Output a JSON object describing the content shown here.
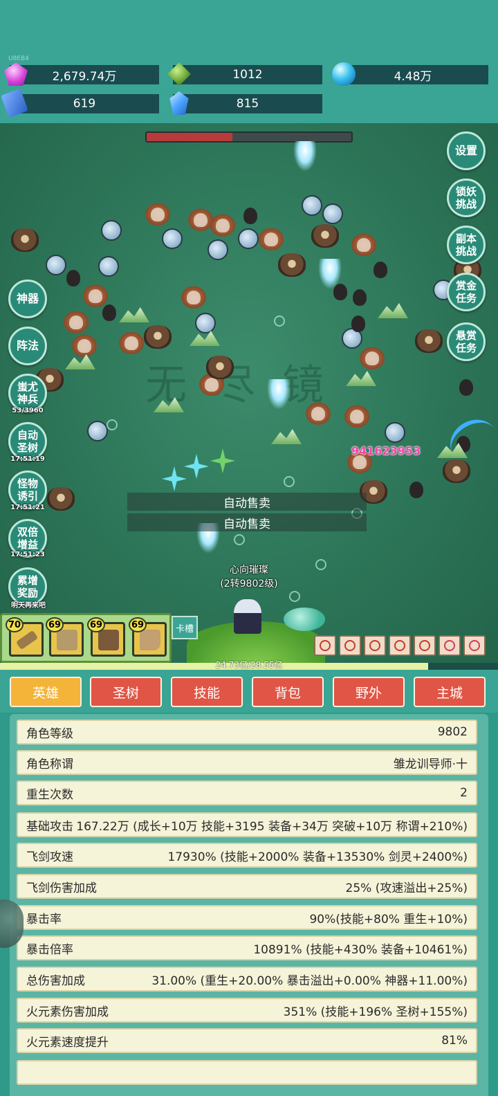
{
  "uid": "U8EB4",
  "resources": [
    {
      "icon": "gem-icon",
      "value": "2,679.74万"
    },
    {
      "icon": "jade-icon",
      "value": "1012"
    },
    {
      "icon": "orb-icon",
      "value": "4.48万"
    },
    {
      "icon": "book-icon",
      "value": "619"
    },
    {
      "icon": "crystal-icon",
      "value": "815"
    }
  ],
  "right_buttons": [
    "设置",
    "锁妖挑战",
    "副本挑战",
    "赏金任务",
    "悬赏任务"
  ],
  "left_buttons": [
    {
      "label": "神器",
      "timer": ""
    },
    {
      "label": "阵法",
      "timer": ""
    },
    {
      "label": "蚩尤神兵",
      "timer": "53/3960"
    },
    {
      "label": "自动圣树",
      "timer": "17:51:19"
    },
    {
      "label": "怪物诱引",
      "timer": "17:51:21"
    },
    {
      "label": "双倍增益",
      "timer": "17:51:23"
    },
    {
      "label": "累增奖励",
      "timer": "明天再来吧"
    }
  ],
  "damage_number": "941623953",
  "auto_sell": [
    "自动售卖",
    "自动售卖"
  ],
  "player": {
    "name": "心向璀璨",
    "level": "(2转9802级)"
  },
  "equipment": [
    {
      "level": "70",
      "icon": "boomerang-icon"
    },
    {
      "level": "69",
      "icon": "shirt-icon"
    },
    {
      "level": "69",
      "icon": "armor-icon"
    },
    {
      "level": "69",
      "icon": "boots-icon"
    }
  ],
  "card_slot": "卡槽",
  "xp_text": "24.73亿/28.55亿",
  "xp_progress": 0.86,
  "hp_progress": 0.42,
  "tabs": [
    "英雄",
    "圣树",
    "技能",
    "背包",
    "野外",
    "主城"
  ],
  "active_tab": 0,
  "stats": [
    {
      "label": "角色等级",
      "value": "9802"
    },
    {
      "label": "角色称谓",
      "value": "雏龙训导师·十"
    },
    {
      "label": "重生次数",
      "value": "2"
    },
    {
      "label": "基础攻击",
      "value": "167.22万 (成长+10万 技能+3195 装备+34万 突破+10万 称谓+210%)"
    },
    {
      "label": "飞剑攻速",
      "value": "17930% (技能+2000% 装备+13530% 剑灵+2400%)"
    },
    {
      "label": "飞剑伤害加成",
      "value": "25% (攻速溢出+25%)"
    },
    {
      "label": "暴击率",
      "value": "90%(技能+80% 重生+10%)"
    },
    {
      "label": "暴击倍率",
      "value": "10891% (技能+430% 装备+10461%)"
    },
    {
      "label": "总伤害加成",
      "value": "31.00% (重生+20.00% 暴击溢出+0.00% 神器+11.00%)"
    },
    {
      "label": "火元素伤害加成",
      "value": "351% (技能+196% 圣树+155%)"
    },
    {
      "label": "火元素速度提升",
      "value": "81%"
    }
  ]
}
